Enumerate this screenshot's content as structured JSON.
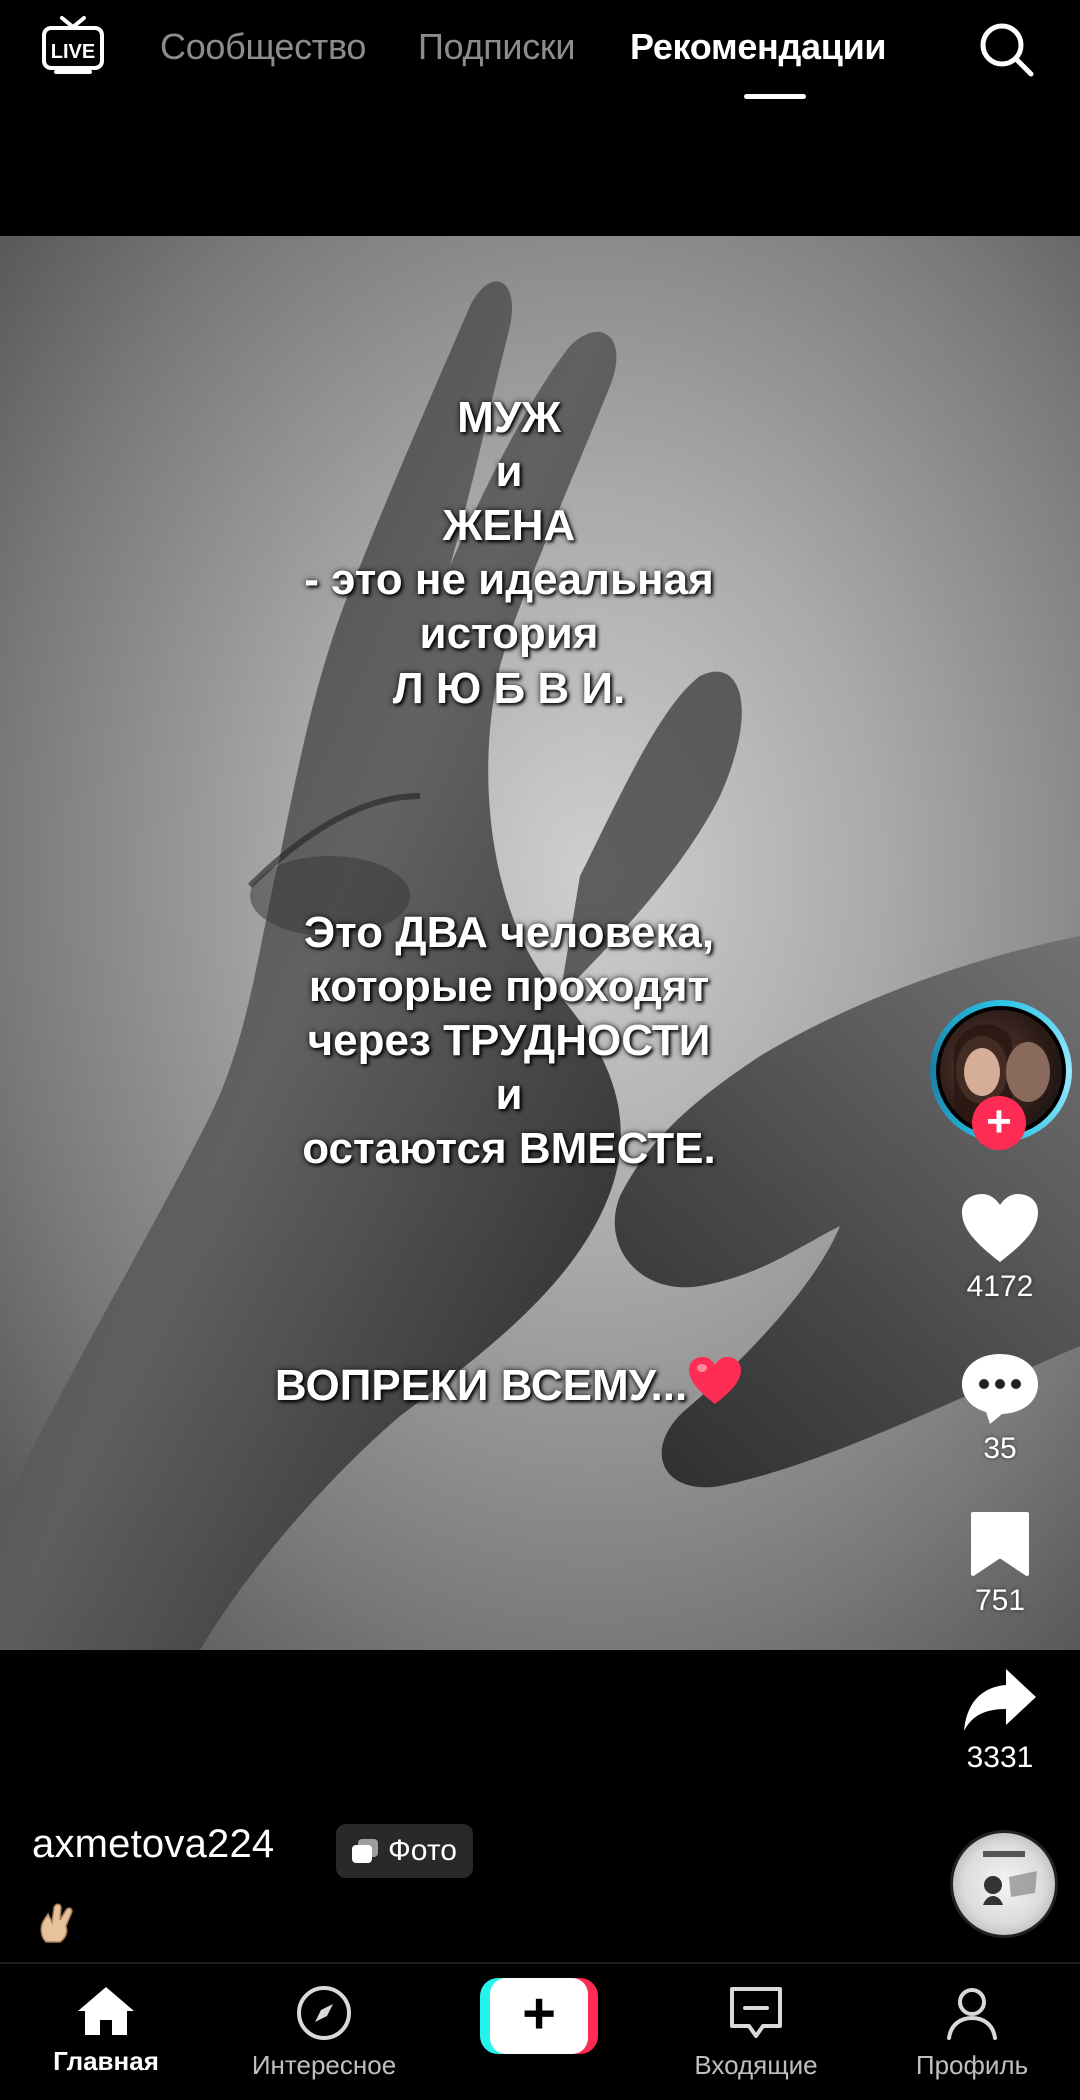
{
  "top_bar": {
    "live_label": "LIVE",
    "tabs": [
      {
        "label": "Сообщество",
        "active": false
      },
      {
        "label": "Подписки",
        "active": false
      },
      {
        "label": "Рекомендации",
        "active": true
      }
    ],
    "search_icon": "search-icon"
  },
  "post": {
    "overlay_text_1": [
      "МУЖ",
      "и",
      "ЖЕНА",
      "- это не идеальная",
      "история",
      "Л Ю Б В И."
    ],
    "overlay_text_2": [
      "Это ДВА человека,",
      "которые проходят",
      "через ТРУДНОСТИ",
      "и",
      "остаются ВМЕСТЕ."
    ],
    "overlay_text_3": "ВОПРЕКИ ВСЕМУ...",
    "overlay_emoji": "heart-emoji",
    "username": "axmetova224",
    "type_badge": "Фото",
    "caption_emoji": "crossed-fingers-emoji"
  },
  "actions": {
    "likes": "4172",
    "comments": "35",
    "saves": "751",
    "shares": "3331",
    "follow_icon": "plus-icon"
  },
  "bottom_nav": {
    "home": "Главная",
    "discover": "Интересное",
    "create": "+",
    "inbox": "Входящие",
    "profile": "Профиль"
  },
  "colors": {
    "accent_red": "#fe2c55",
    "accent_cyan": "#25f4ee",
    "background": "#000000"
  }
}
